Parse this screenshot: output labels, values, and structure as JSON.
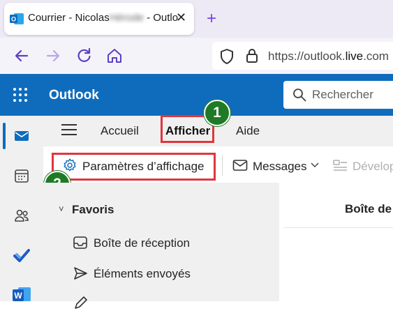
{
  "browser": {
    "tab": {
      "title_prefix": "Courrier - Nicolas",
      "title_redacted": "Hérode",
      "title_suffix": " - Outlo",
      "close_glyph": "✕"
    },
    "new_tab_glyph": "+",
    "url": {
      "scheme": "https://outlook.",
      "domain": "live",
      "rest": ".com"
    }
  },
  "outlook": {
    "brand": "Outlook",
    "search_placeholder": "Rechercher",
    "ribbon_tabs": [
      {
        "label": "Accueil"
      },
      {
        "label": "Afficher"
      },
      {
        "label": "Aide"
      }
    ],
    "tools": {
      "view_settings": "Paramètres d’affichage",
      "messages": "Messages",
      "developer": "Dévelop"
    },
    "folder_pane": {
      "favorites_label": "Favoris",
      "folders": [
        {
          "label": "Boîte de réception"
        },
        {
          "label": "Éléments envoyés"
        }
      ]
    },
    "message_list_title": "Boîte de"
  },
  "annotations": {
    "step1": "1",
    "step2": "2"
  },
  "colors": {
    "outlook_blue": "#0f6cbd",
    "highlight_red": "#e0353d",
    "badge_green": "#1f7a26",
    "firefox_purple": "#7542e5"
  }
}
